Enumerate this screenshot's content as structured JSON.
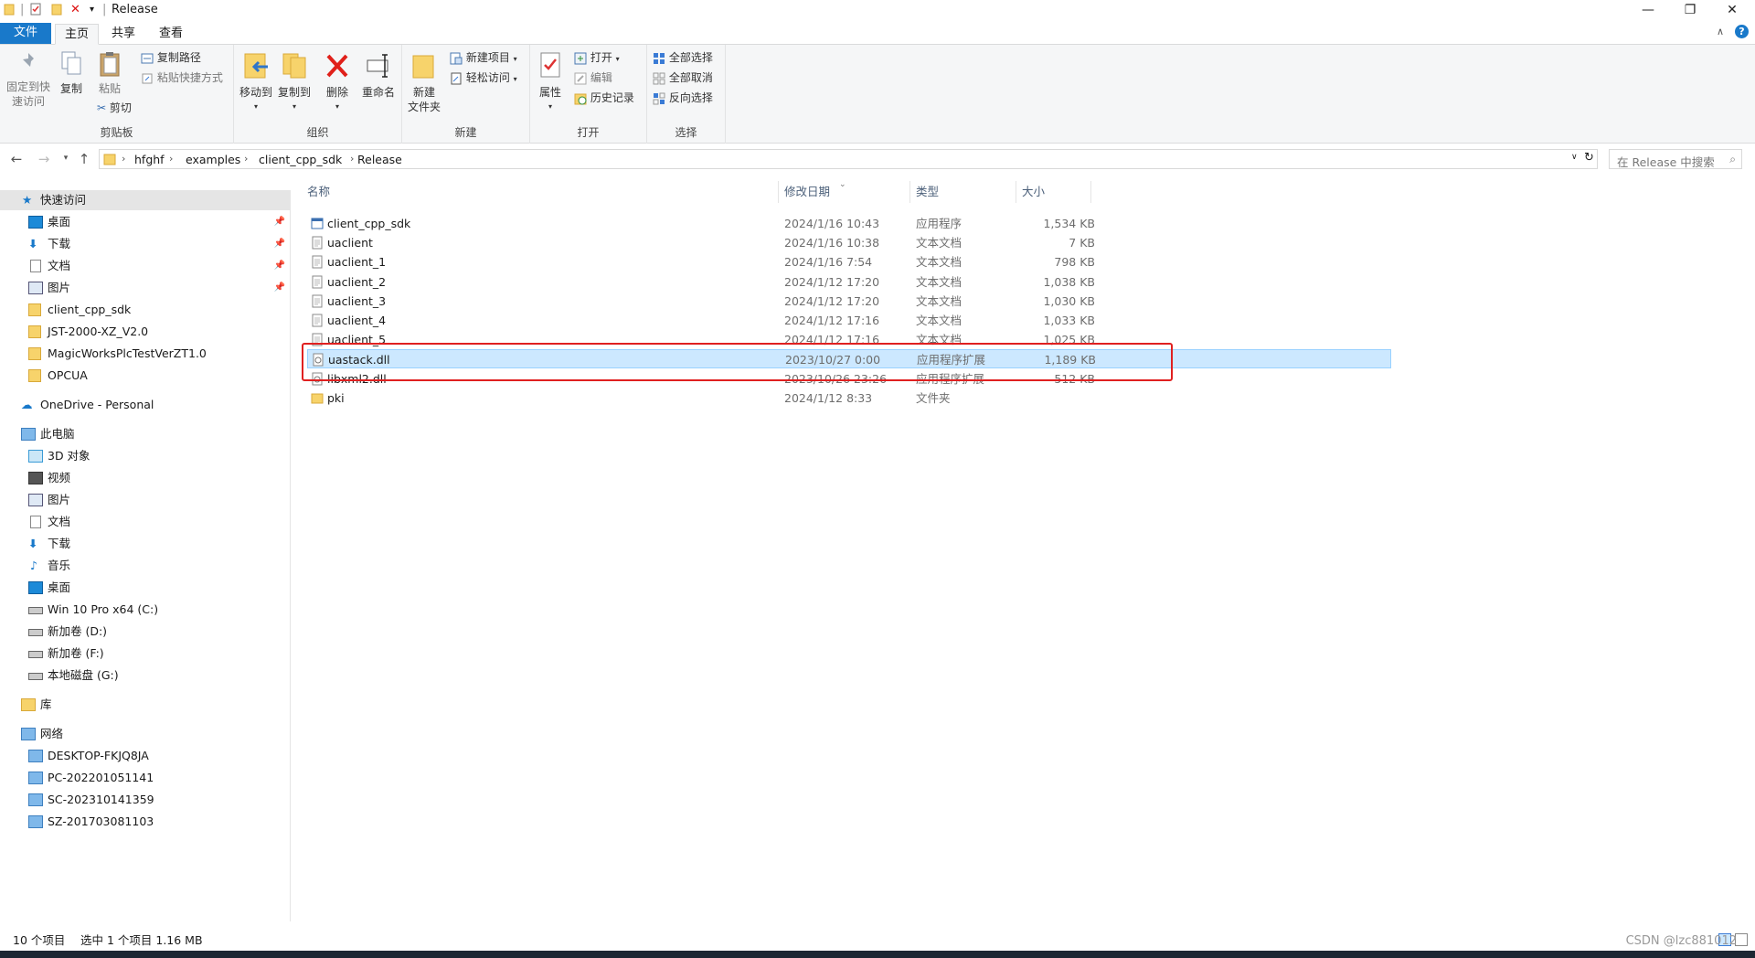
{
  "window": {
    "title": "Release",
    "controls": {
      "minimize": "—",
      "restore": "❐",
      "close": "✕"
    }
  },
  "tabs": [
    {
      "label": "文件"
    },
    {
      "label": "主页"
    },
    {
      "label": "共享"
    },
    {
      "label": "查看"
    }
  ],
  "ribbon": {
    "clipboard": {
      "pin_label_1": "固定到快",
      "pin_label_2": "速访问",
      "copy": "复制",
      "paste": "粘贴",
      "copy_path": "复制路径",
      "paste_shortcut": "粘贴快捷方式",
      "cut": "剪切",
      "group": "剪贴板"
    },
    "organize": {
      "move_to": "移动到",
      "copy_to": "复制到",
      "delete": "删除",
      "rename": "重命名",
      "group": "组织"
    },
    "new": {
      "new_folder_1": "新建",
      "new_folder_2": "文件夹",
      "new_item": "新建项目",
      "easy_access": "轻松访问",
      "group": "新建"
    },
    "open": {
      "properties": "属性",
      "open": "打开",
      "edit": "编辑",
      "history": "历史记录",
      "group": "打开"
    },
    "select": {
      "select_all": "全部选择",
      "select_none": "全部取消",
      "invert": "反向选择",
      "group": "选择"
    }
  },
  "address": {
    "crumbs": [
      "hfghf",
      "examples",
      "client_cpp_sdk",
      "Release"
    ],
    "search_placeholder": "在 Release 中搜索"
  },
  "sidebar": {
    "quick_access": "快速访问",
    "quick_items": [
      "桌面",
      "下载",
      "文档",
      "图片",
      "client_cpp_sdk",
      "JST-2000-XZ_V2.0",
      "MagicWorksPlcTestVerZT1.0",
      "OPCUA"
    ],
    "onedrive": "OneDrive - Personal",
    "this_pc": "此电脑",
    "pc_items": [
      "3D 对象",
      "视频",
      "图片",
      "文档",
      "下载",
      "音乐",
      "桌面",
      "Win 10 Pro x64 (C:)",
      "新加卷 (D:)",
      "新加卷 (F:)",
      "本地磁盘 (G:)"
    ],
    "library": "库",
    "network": "网络",
    "network_items": [
      "DESKTOP-FKJQ8JA",
      "PC-202201051141",
      "SC-202310141359",
      "SZ-201703081103"
    ]
  },
  "columns": {
    "name": "名称",
    "modified": "修改日期",
    "type": "类型",
    "size": "大小"
  },
  "files": [
    {
      "name": "client_cpp_sdk",
      "modified": "2024/1/16 10:43",
      "type": "应用程序",
      "size": "1,534 KB",
      "icon": "exe-icon"
    },
    {
      "name": "uaclient",
      "modified": "2024/1/16 10:38",
      "type": "文本文档",
      "size": "7 KB",
      "icon": "text-file-icon"
    },
    {
      "name": "uaclient_1",
      "modified": "2024/1/16 7:54",
      "type": "文本文档",
      "size": "798 KB",
      "icon": "text-file-icon"
    },
    {
      "name": "uaclient_2",
      "modified": "2024/1/12 17:20",
      "type": "文本文档",
      "size": "1,038 KB",
      "icon": "text-file-icon"
    },
    {
      "name": "uaclient_3",
      "modified": "2024/1/12 17:20",
      "type": "文本文档",
      "size": "1,030 KB",
      "icon": "text-file-icon"
    },
    {
      "name": "uaclient_4",
      "modified": "2024/1/12 17:16",
      "type": "文本文档",
      "size": "1,033 KB",
      "icon": "text-file-icon"
    },
    {
      "name": "uaclient_5",
      "modified": "2024/1/12 17:16",
      "type": "文本文档",
      "size": "1,025 KB",
      "icon": "text-file-icon"
    },
    {
      "name": "uastack.dll",
      "modified": "2023/10/27 0:00",
      "type": "应用程序扩展",
      "size": "1,189 KB",
      "icon": "dll-icon"
    },
    {
      "name": "libxml2.dll",
      "modified": "2023/10/26 23:26",
      "type": "应用程序扩展",
      "size": "512 KB",
      "icon": "dll-icon"
    },
    {
      "name": "pki",
      "modified": "2024/1/12 8:33",
      "type": "文件夹",
      "size": "",
      "icon": "folder-icon"
    }
  ],
  "status": {
    "count": "10 个项目",
    "selection": "选中 1 个项目  1.16 MB"
  },
  "watermark": "CSDN @lzc881012",
  "colors": {
    "accent": "#1979ca",
    "selection": "#cce8ff",
    "highlight_box": "#e02020",
    "folder": "#f7d36b"
  }
}
